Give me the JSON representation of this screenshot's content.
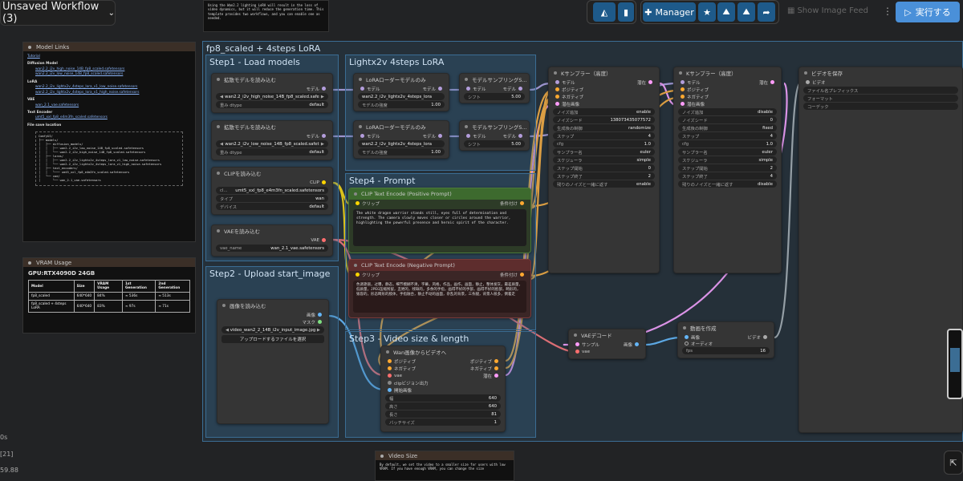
{
  "topbar": {
    "workflow_name": "Unsaved Workflow (3)",
    "manager_label": "Manager",
    "show_feed_label": "Show Image Feed",
    "run_label": "実行する"
  },
  "top_note": {
    "text": "Using the Wan2.2 lighting LoRA will result in the loss of video dynamics, but it will reduce the generation time. This template provides two workflows, and you can enable one as needed."
  },
  "model_links": {
    "title": "Model Links",
    "tutorial": "Tutorial",
    "diffusion_header": "Diffusion Model",
    "diffusion": [
      "wan2.2_i2v_high_noise_14B_fp8_scaled.safetensors",
      "wan2.2_i2v_low_noise_14B_fp8_scaled.safetensors"
    ],
    "lora_header": "LoRA",
    "lora": [
      "wan2.2_i2v_lightx2v_4steps_lora_v1_low_noise.safetensors",
      "wan2.2_i2v_lightx2v_4steps_lora_v1_high_noise.safetensors"
    ],
    "vae_header": "VAE",
    "vae": [
      "wan_2.1_vae.safetensors"
    ],
    "te_header": "Text Encoder",
    "te": [
      "umt5_xxl_fp8_e4m3fn_scaled.safetensors"
    ],
    "save_header": "File save location",
    "tree": "ComfyUI/\n├── models/\n│   ├── diffusion_models/\n│   │   ├── wan2.2_i2v_low_noise_14B_fp8_scaled.safetensors\n│   │   └── wan2.2_i2v_high_noise_14B_fp8_scaled.safetensors\n│   ├── loras/\n│   │   ├── wan2.2_i2v_lightx2v_4steps_lora_v1_low_noise.safetensors\n│   │   └── wan2.2_i2v_lightx2v_4steps_lora_v1_high_noise.safetensors\n│   ├── text_encoders/\n│   │   └─── umt5_xxl_fp8_e4m3fn_scaled.safetensors\n│   └── vae/\n│       └── wan_2.1_vae.safetensors"
  },
  "vram": {
    "title": "VRAM Usage",
    "gpu": "GPU:RTX4090D 24GB",
    "headers": [
      "Model",
      "Size",
      "VRAM Usage",
      "1st Generation",
      "2nd Generation"
    ],
    "rows": [
      [
        "fp8_scaled",
        "640*640",
        "84%",
        "≈ 536s",
        "≈ 513s"
      ],
      [
        "fp8_scaled + 4steps LoRA",
        "640*640",
        "83%",
        "≈ 97s",
        "≈ 71s"
      ]
    ]
  },
  "video_size_note": {
    "title": "Video Size",
    "text": "By default, we set the video to a smaller size for users with low VRAM. If you have enough VRAM, you can change the size"
  },
  "left_stats": [
    "0s",
    "[21]",
    "59.88"
  ],
  "groups": {
    "main": "fp8_scaled + 4steps LoRA",
    "step1": "Step1 - Load models",
    "lightx": "Lightx2v 4steps LoRA",
    "step2": "Step2 - Upload start_image",
    "step3": "Step3 - Video size & length",
    "step4": "Step4 - Prompt"
  },
  "nodes": {
    "unet_high": {
      "title": "拡散モデルを読み込む",
      "out": "モデル",
      "name": "wan2.2_i2v_high_noise_14B_fp8_scaled.safe",
      "dtype_label": "重み dtype",
      "dtype": "default"
    },
    "unet_low": {
      "title": "拡散モデルを読み込む",
      "out": "モデル",
      "name": "wan2.2_i2v_low_noise_14B_fp8_scaled.safet",
      "dtype_label": "重み dtype",
      "dtype": "default"
    },
    "clip": {
      "title": "CLIPを読み込む",
      "out": "CLIP",
      "name_label": "cl...",
      "name": "umt5_xxl_fp8_e4m3fn_scaled.safetensors",
      "type_label": "タイプ",
      "type": "wan",
      "device_label": "デバイス",
      "device": "default"
    },
    "vae": {
      "title": "VAEを読み込む",
      "out": "VAE",
      "name_label": "vae_name",
      "name": "wan_2.1_vae.safetensors"
    },
    "lora_high": {
      "title": "LoRAローダーモデルのみ",
      "in": "モデル",
      "out": "モデル",
      "name": "wan2.2_i2v_lightx2v_4steps_lora",
      "strength_label": "モデルの強度",
      "strength": "1.00"
    },
    "lora_low": {
      "title": "LoRAローダーモデルのみ",
      "in": "モデル",
      "out": "モデル",
      "name": "wan2.2_i2v_lightx2v_4steps_lora",
      "strength_label": "モデルの強度",
      "strength": "1.00"
    },
    "sampling1": {
      "title": "モデルサンプリングS...",
      "in": "モデル",
      "out": "モデル",
      "shift_label": "シフト",
      "shift": "5.00"
    },
    "sampling2": {
      "title": "モデルサンプリングS...",
      "in": "モデル",
      "out": "モデル",
      "shift_label": "シフト",
      "shift": "5.00"
    },
    "pos_prompt": {
      "title": "CLIP Text Encode (Positive Prompt)",
      "in": "クリップ",
      "out": "条件付け",
      "text": "The white dragon warrior stands still, eyes full of determination and strength. The camera slowly moves closer or circles around the warrior, highlighting the powerful presence and heroic spirit of the character."
    },
    "neg_prompt": {
      "title": "CLIP Text Encode (Negative Prompt)",
      "in": "クリップ",
      "out": "条件付け",
      "text": "色调艳丽，过曝，静态，细节模糊不清，字幕，风格，作品，画作，画面，静止，整体发灰，最差质量，低质量，JPEG压缩残留，丑陋的，残缺的，多余的手指，画得不好的手部，画得不好的脸部，畸形的，毁容的，形态畸形的肢体，手指融合，静止不动的画面，杂乱的背景，三条腿，背景人很多，倒着走"
    },
    "load_image": {
      "title": "画像を読み込む",
      "out1": "画像",
      "out2": "マスク",
      "file": "video_wan2_2_14B_i2v_input_image.jpg",
      "upload": "アップロードするファイルを選択"
    },
    "wan_i2v": {
      "title": "Wan画像からビデオへ",
      "in": [
        "ポジティブ",
        "ネガティブ",
        "vae",
        "clipビジョン出力",
        "開始画像"
      ],
      "out": [
        "ポジティブ",
        "ネガティブ",
        "潜在"
      ],
      "widgets": [
        [
          "幅",
          "640"
        ],
        [
          "高さ",
          "640"
        ],
        [
          "長さ",
          "81"
        ],
        [
          "バッチサイズ",
          "1"
        ]
      ]
    },
    "ksampler1": {
      "title": "Kサンプラー（高度）",
      "in": [
        "モデル",
        "ポジティブ",
        "ネガティブ",
        "潜在画像"
      ],
      "out": "潜在",
      "widgets": [
        [
          "ノイズ追加",
          "enable"
        ],
        [
          "ノイズシード",
          "138073435077572"
        ],
        [
          "生成後の制御",
          "randomize"
        ],
        [
          "ステップ",
          "4"
        ],
        [
          "cfg",
          "1.0"
        ],
        [
          "サンプラー名",
          "euler"
        ],
        [
          "スケジューラ",
          "simple"
        ],
        [
          "ステップ開始",
          "0"
        ],
        [
          "ステップ終了",
          "2"
        ],
        [
          "残りのノイズと一緒に返す",
          "enable"
        ]
      ]
    },
    "ksampler2": {
      "title": "Kサンプラー（高度）",
      "in": [
        "モデル",
        "ポジティブ",
        "ネガティブ",
        "潜在画像"
      ],
      "out": "潜在",
      "widgets": [
        [
          "ノイズ追加",
          "disable"
        ],
        [
          "ノイズシード",
          "0"
        ],
        [
          "生成後の制御",
          "fixed"
        ],
        [
          "ステップ",
          "4"
        ],
        [
          "cfg",
          "1.0"
        ],
        [
          "サンプラー名",
          "euler"
        ],
        [
          "スケジューラ",
          "simple"
        ],
        [
          "ステップ開始",
          "2"
        ],
        [
          "ステップ終了",
          "4"
        ],
        [
          "残りのノイズと一緒に返す",
          "disable"
        ]
      ]
    },
    "save_video": {
      "title": "ビデオを保存",
      "in": "ビデオ",
      "widgets": [
        "ファイル名プレフィックス",
        "フォーマット",
        "コーデック"
      ]
    },
    "vae_decode": {
      "title": "VAEデコード",
      "in": [
        "サンプル",
        "vae"
      ],
      "out": "画像"
    },
    "create_video": {
      "title": "動画を作成",
      "in": [
        "画像",
        "オーディオ"
      ],
      "out": "ビデオ",
      "fps_label": "fps",
      "fps": "16"
    }
  }
}
